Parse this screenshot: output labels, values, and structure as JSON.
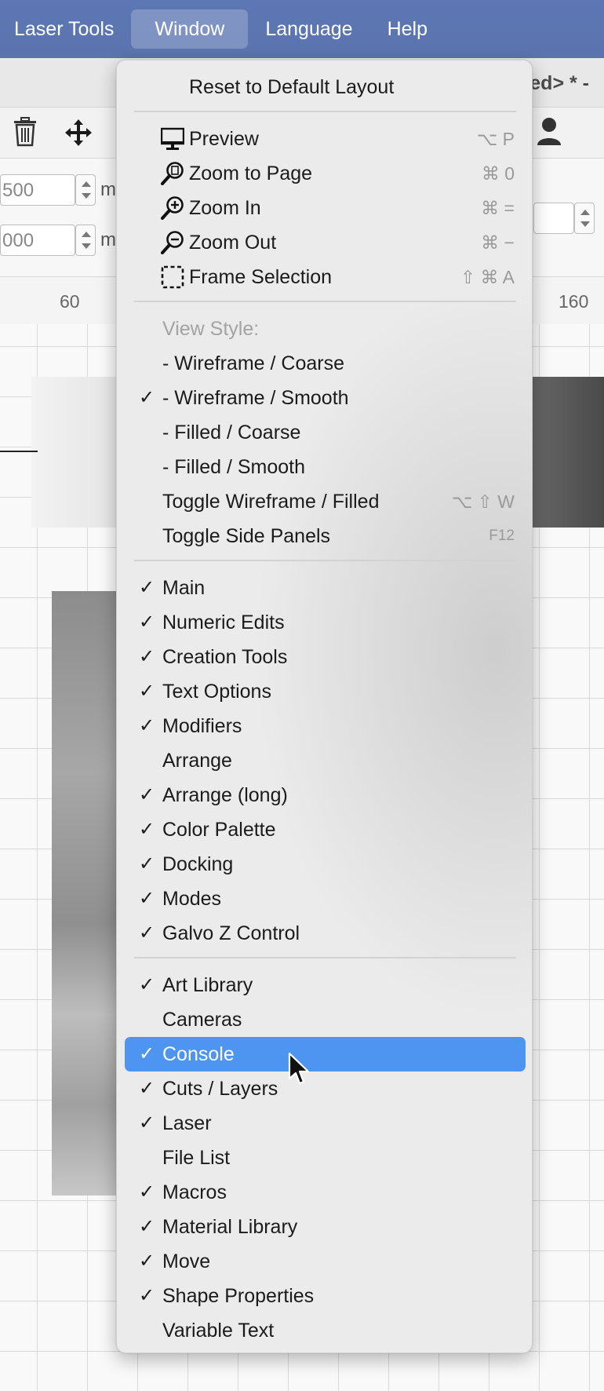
{
  "menubar": {
    "items": [
      "Laser Tools",
      "Window",
      "Language",
      "Help"
    ],
    "active": "Window"
  },
  "document": {
    "title_fragment": "tled> * -"
  },
  "numeric": {
    "field1": "500",
    "field2": "000",
    "unit": "m"
  },
  "ruler": {
    "ticks": [
      "60",
      "160"
    ]
  },
  "window_menu": {
    "reset": {
      "label": "Reset to Default Layout"
    },
    "view": [
      {
        "label": "Preview",
        "icon": "monitor-icon",
        "shortcut": "⌥ P"
      },
      {
        "label": "Zoom to Page",
        "icon": "zoom-page-icon",
        "shortcut": "⌘ 0"
      },
      {
        "label": "Zoom In",
        "icon": "zoom-in-icon",
        "shortcut": "⌘ ="
      },
      {
        "label": "Zoom Out",
        "icon": "zoom-out-icon",
        "shortcut": "⌘ −"
      },
      {
        "label": "Frame Selection",
        "icon": "frame-selection-icon",
        "shortcut": "⇧ ⌘ A"
      }
    ],
    "view_style_header": "View Style:",
    "view_styles": [
      {
        "label": "-  Wireframe / Coarse",
        "checked": false
      },
      {
        "label": "-  Wireframe / Smooth",
        "checked": true
      },
      {
        "label": "-  Filled / Coarse",
        "checked": false
      },
      {
        "label": "-  Filled / Smooth",
        "checked": false
      }
    ],
    "toggles": [
      {
        "label": "Toggle Wireframe / Filled",
        "shortcut": "⌥ ⇧ W"
      },
      {
        "label": "Toggle Side Panels",
        "shortcut": "F12"
      }
    ],
    "toolbars": [
      {
        "label": "Main",
        "checked": true
      },
      {
        "label": "Numeric Edits",
        "checked": true
      },
      {
        "label": "Creation Tools",
        "checked": true
      },
      {
        "label": "Text Options",
        "checked": true
      },
      {
        "label": "Modifiers",
        "checked": true
      },
      {
        "label": "Arrange",
        "checked": false
      },
      {
        "label": "Arrange (long)",
        "checked": true
      },
      {
        "label": "Color Palette",
        "checked": true
      },
      {
        "label": "Docking",
        "checked": true
      },
      {
        "label": "Modes",
        "checked": true
      },
      {
        "label": "Galvo Z Control",
        "checked": true
      }
    ],
    "windows": [
      {
        "label": "Art Library",
        "checked": true
      },
      {
        "label": "Cameras",
        "checked": false
      },
      {
        "label": "Console",
        "checked": true,
        "selected": true
      },
      {
        "label": "Cuts / Layers",
        "checked": true
      },
      {
        "label": "Laser",
        "checked": true
      },
      {
        "label": "File List",
        "checked": false
      },
      {
        "label": "Macros",
        "checked": true
      },
      {
        "label": "Material Library",
        "checked": true
      },
      {
        "label": "Move",
        "checked": true
      },
      {
        "label": "Shape Properties",
        "checked": true
      },
      {
        "label": "Variable Text",
        "checked": false
      }
    ],
    "check_glyph": "✓"
  },
  "colors": {
    "menubar": "#5d77b4",
    "selection": "#4e95f1",
    "menu_bg": "#ebebeb"
  }
}
